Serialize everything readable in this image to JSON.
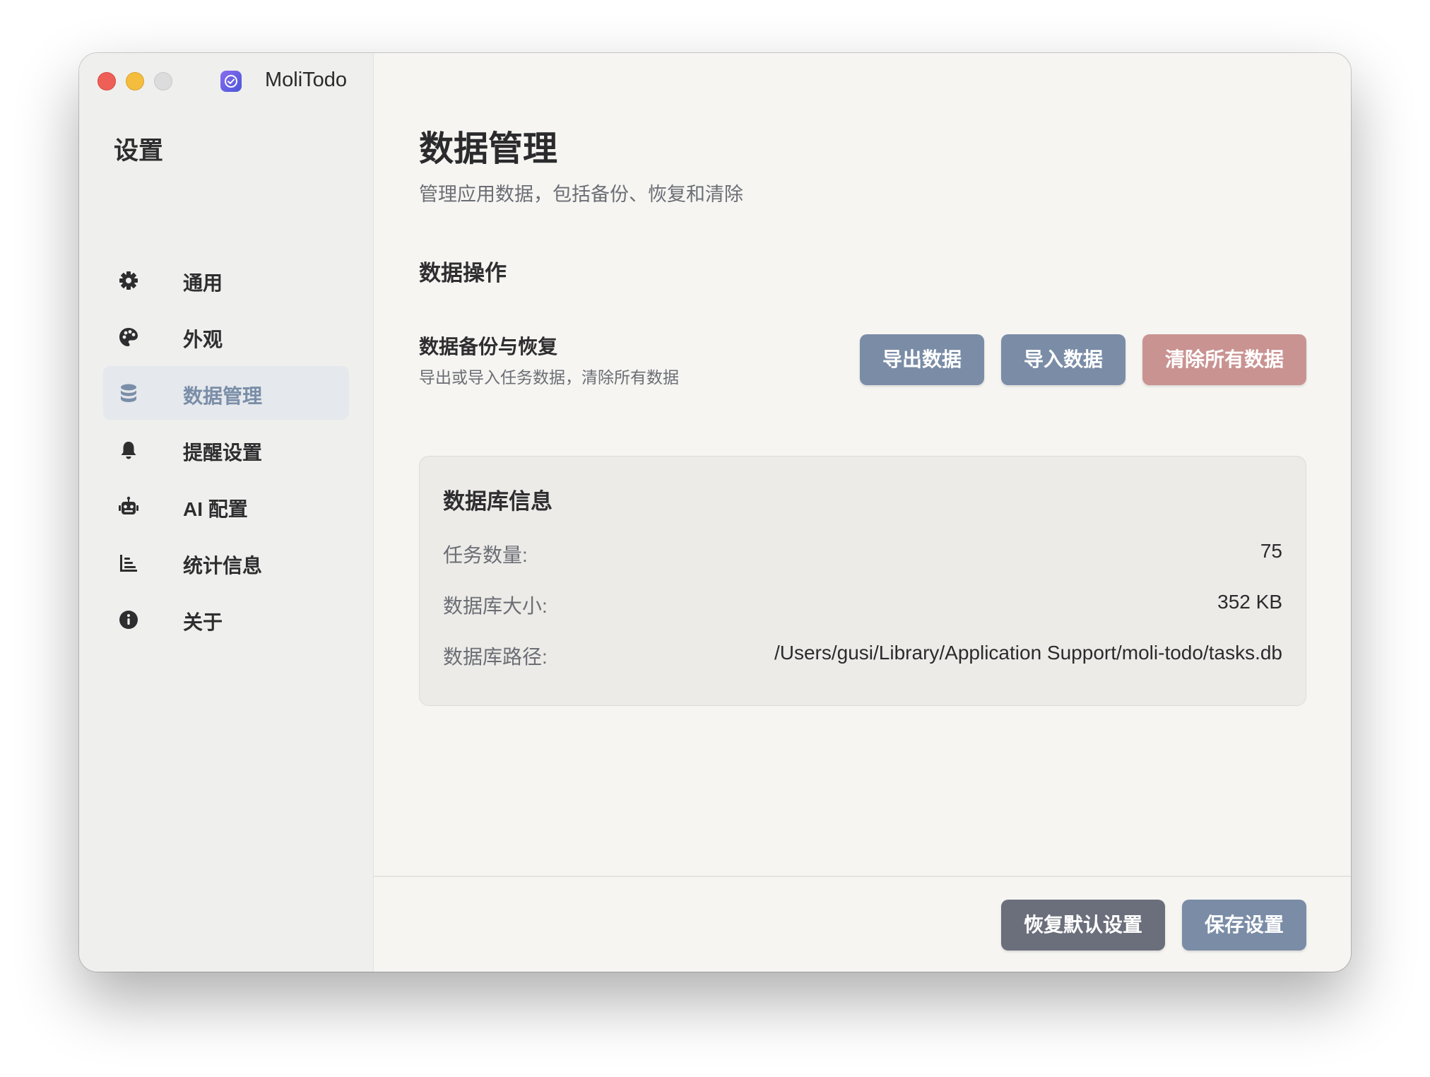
{
  "window": {
    "app_title": "MoliTodo",
    "app_icon": "check-badge-icon"
  },
  "sidebar": {
    "heading": "设置",
    "items": [
      {
        "label": "通用",
        "icon": "gear-icon"
      },
      {
        "label": "外观",
        "icon": "palette-icon"
      },
      {
        "label": "数据管理",
        "icon": "database-icon",
        "active": true
      },
      {
        "label": "提醒设置",
        "icon": "bell-icon"
      },
      {
        "label": "AI 配置",
        "icon": "robot-icon"
      },
      {
        "label": "统计信息",
        "icon": "chart-icon"
      },
      {
        "label": "关于",
        "icon": "info-icon"
      }
    ]
  },
  "main": {
    "title": "数据管理",
    "subtitle": "管理应用数据，包括备份、恢复和清除",
    "section_title": "数据操作",
    "backup_row": {
      "title": "数据备份与恢复",
      "description": "导出或导入任务数据，清除所有数据",
      "export_label": "导出数据",
      "import_label": "导入数据",
      "clear_label": "清除所有数据"
    },
    "db_info": {
      "title": "数据库信息",
      "task_count_label": "任务数量:",
      "task_count_value": "75",
      "size_label": "数据库大小:",
      "size_value": "352 KB",
      "path_label": "数据库路径:",
      "path_value": "/Users/gusi/Library/Application Support/moli-todo/tasks.db"
    }
  },
  "footer": {
    "reset_label": "恢复默认设置",
    "save_label": "保存设置"
  },
  "colors": {
    "accent_blue": "#7a8ca6",
    "danger": "#c99391",
    "dark_button": "#6b6f7b",
    "active_nav_text": "#7a8ea8"
  }
}
